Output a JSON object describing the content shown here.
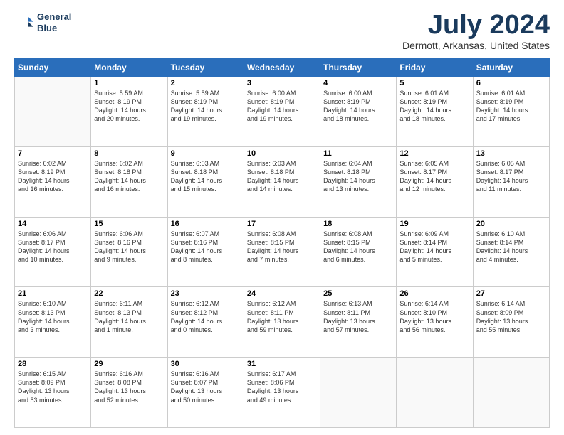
{
  "logo": {
    "line1": "General",
    "line2": "Blue"
  },
  "title": "July 2024",
  "location": "Dermott, Arkansas, United States",
  "days_of_week": [
    "Sunday",
    "Monday",
    "Tuesday",
    "Wednesday",
    "Thursday",
    "Friday",
    "Saturday"
  ],
  "weeks": [
    [
      {
        "day": "",
        "info": ""
      },
      {
        "day": "1",
        "info": "Sunrise: 5:59 AM\nSunset: 8:19 PM\nDaylight: 14 hours\nand 20 minutes."
      },
      {
        "day": "2",
        "info": "Sunrise: 5:59 AM\nSunset: 8:19 PM\nDaylight: 14 hours\nand 19 minutes."
      },
      {
        "day": "3",
        "info": "Sunrise: 6:00 AM\nSunset: 8:19 PM\nDaylight: 14 hours\nand 19 minutes."
      },
      {
        "day": "4",
        "info": "Sunrise: 6:00 AM\nSunset: 8:19 PM\nDaylight: 14 hours\nand 18 minutes."
      },
      {
        "day": "5",
        "info": "Sunrise: 6:01 AM\nSunset: 8:19 PM\nDaylight: 14 hours\nand 18 minutes."
      },
      {
        "day": "6",
        "info": "Sunrise: 6:01 AM\nSunset: 8:19 PM\nDaylight: 14 hours\nand 17 minutes."
      }
    ],
    [
      {
        "day": "7",
        "info": "Sunrise: 6:02 AM\nSunset: 8:19 PM\nDaylight: 14 hours\nand 16 minutes."
      },
      {
        "day": "8",
        "info": "Sunrise: 6:02 AM\nSunset: 8:18 PM\nDaylight: 14 hours\nand 16 minutes."
      },
      {
        "day": "9",
        "info": "Sunrise: 6:03 AM\nSunset: 8:18 PM\nDaylight: 14 hours\nand 15 minutes."
      },
      {
        "day": "10",
        "info": "Sunrise: 6:03 AM\nSunset: 8:18 PM\nDaylight: 14 hours\nand 14 minutes."
      },
      {
        "day": "11",
        "info": "Sunrise: 6:04 AM\nSunset: 8:18 PM\nDaylight: 14 hours\nand 13 minutes."
      },
      {
        "day": "12",
        "info": "Sunrise: 6:05 AM\nSunset: 8:17 PM\nDaylight: 14 hours\nand 12 minutes."
      },
      {
        "day": "13",
        "info": "Sunrise: 6:05 AM\nSunset: 8:17 PM\nDaylight: 14 hours\nand 11 minutes."
      }
    ],
    [
      {
        "day": "14",
        "info": "Sunrise: 6:06 AM\nSunset: 8:17 PM\nDaylight: 14 hours\nand 10 minutes."
      },
      {
        "day": "15",
        "info": "Sunrise: 6:06 AM\nSunset: 8:16 PM\nDaylight: 14 hours\nand 9 minutes."
      },
      {
        "day": "16",
        "info": "Sunrise: 6:07 AM\nSunset: 8:16 PM\nDaylight: 14 hours\nand 8 minutes."
      },
      {
        "day": "17",
        "info": "Sunrise: 6:08 AM\nSunset: 8:15 PM\nDaylight: 14 hours\nand 7 minutes."
      },
      {
        "day": "18",
        "info": "Sunrise: 6:08 AM\nSunset: 8:15 PM\nDaylight: 14 hours\nand 6 minutes."
      },
      {
        "day": "19",
        "info": "Sunrise: 6:09 AM\nSunset: 8:14 PM\nDaylight: 14 hours\nand 5 minutes."
      },
      {
        "day": "20",
        "info": "Sunrise: 6:10 AM\nSunset: 8:14 PM\nDaylight: 14 hours\nand 4 minutes."
      }
    ],
    [
      {
        "day": "21",
        "info": "Sunrise: 6:10 AM\nSunset: 8:13 PM\nDaylight: 14 hours\nand 3 minutes."
      },
      {
        "day": "22",
        "info": "Sunrise: 6:11 AM\nSunset: 8:13 PM\nDaylight: 14 hours\nand 1 minute."
      },
      {
        "day": "23",
        "info": "Sunrise: 6:12 AM\nSunset: 8:12 PM\nDaylight: 14 hours\nand 0 minutes."
      },
      {
        "day": "24",
        "info": "Sunrise: 6:12 AM\nSunset: 8:11 PM\nDaylight: 13 hours\nand 59 minutes."
      },
      {
        "day": "25",
        "info": "Sunrise: 6:13 AM\nSunset: 8:11 PM\nDaylight: 13 hours\nand 57 minutes."
      },
      {
        "day": "26",
        "info": "Sunrise: 6:14 AM\nSunset: 8:10 PM\nDaylight: 13 hours\nand 56 minutes."
      },
      {
        "day": "27",
        "info": "Sunrise: 6:14 AM\nSunset: 8:09 PM\nDaylight: 13 hours\nand 55 minutes."
      }
    ],
    [
      {
        "day": "28",
        "info": "Sunrise: 6:15 AM\nSunset: 8:09 PM\nDaylight: 13 hours\nand 53 minutes."
      },
      {
        "day": "29",
        "info": "Sunrise: 6:16 AM\nSunset: 8:08 PM\nDaylight: 13 hours\nand 52 minutes."
      },
      {
        "day": "30",
        "info": "Sunrise: 6:16 AM\nSunset: 8:07 PM\nDaylight: 13 hours\nand 50 minutes."
      },
      {
        "day": "31",
        "info": "Sunrise: 6:17 AM\nSunset: 8:06 PM\nDaylight: 13 hours\nand 49 minutes."
      },
      {
        "day": "",
        "info": ""
      },
      {
        "day": "",
        "info": ""
      },
      {
        "day": "",
        "info": ""
      }
    ]
  ]
}
